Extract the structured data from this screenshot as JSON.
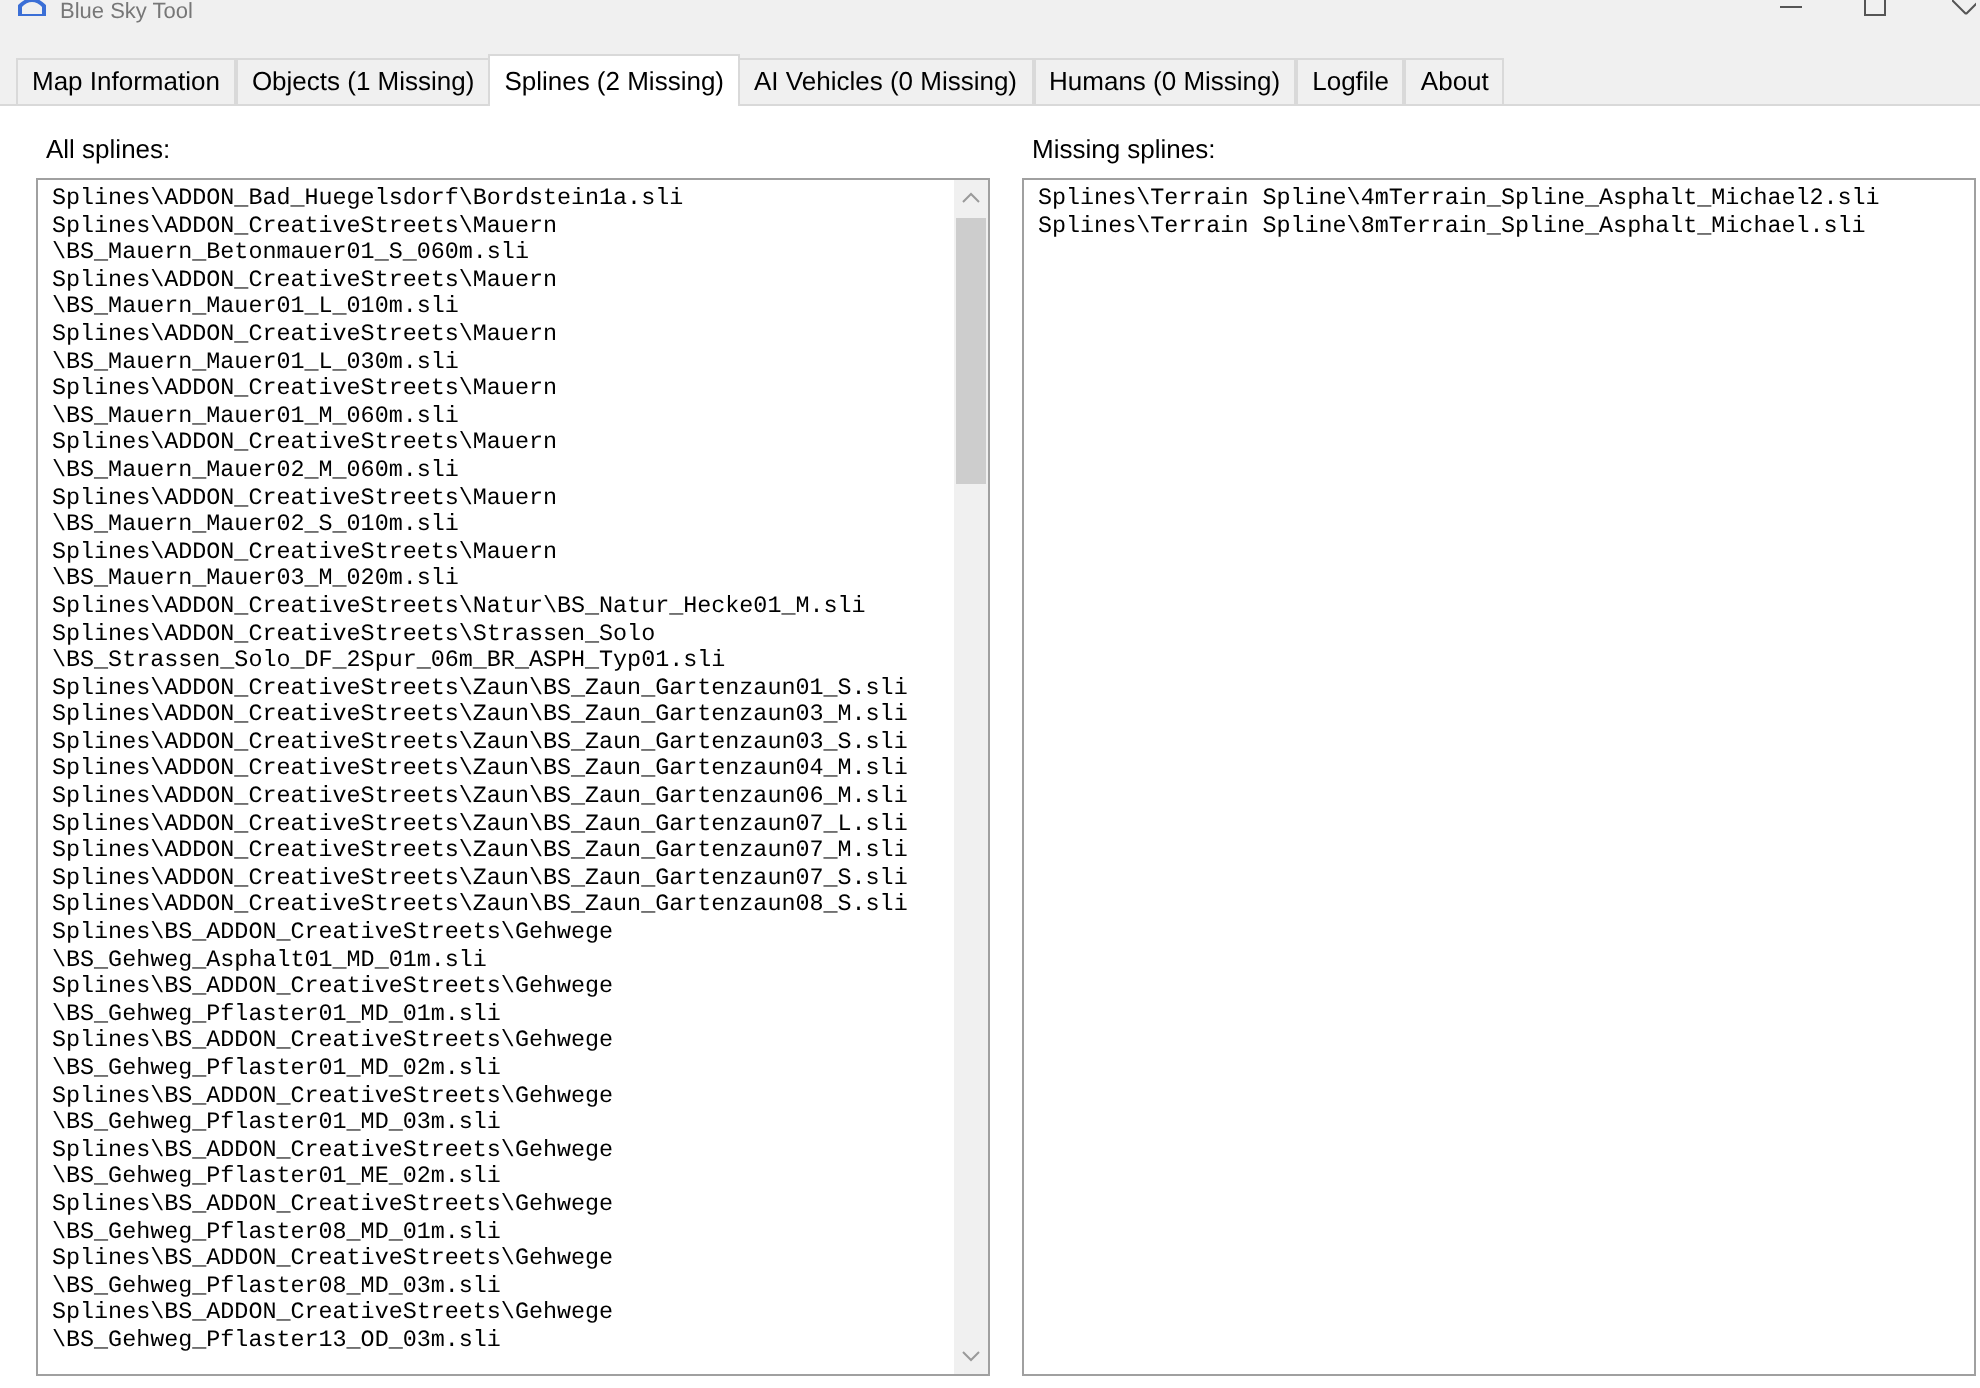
{
  "window": {
    "title": "Blue Sky Tool"
  },
  "tabs": [
    {
      "label": "Map Information",
      "selected": false
    },
    {
      "label": "Objects (1 Missing)",
      "selected": false
    },
    {
      "label": "Splines (2 Missing)",
      "selected": true
    },
    {
      "label": "AI Vehicles (0 Missing)",
      "selected": false
    },
    {
      "label": "Humans (0 Missing)",
      "selected": false
    },
    {
      "label": "Logfile",
      "selected": false
    },
    {
      "label": "About",
      "selected": false
    }
  ],
  "all_splines": {
    "label": "All splines:",
    "lines": [
      "Splines\\ADDON_Bad_Huegelsdorf\\Bordstein1a.sli",
      "Splines\\ADDON_CreativeStreets\\Mauern",
      "\\BS_Mauern_Betonmauer01_S_060m.sli",
      "Splines\\ADDON_CreativeStreets\\Mauern",
      "\\BS_Mauern_Mauer01_L_010m.sli",
      "Splines\\ADDON_CreativeStreets\\Mauern",
      "\\BS_Mauern_Mauer01_L_030m.sli",
      "Splines\\ADDON_CreativeStreets\\Mauern",
      "\\BS_Mauern_Mauer01_M_060m.sli",
      "Splines\\ADDON_CreativeStreets\\Mauern",
      "\\BS_Mauern_Mauer02_M_060m.sli",
      "Splines\\ADDON_CreativeStreets\\Mauern",
      "\\BS_Mauern_Mauer02_S_010m.sli",
      "Splines\\ADDON_CreativeStreets\\Mauern",
      "\\BS_Mauern_Mauer03_M_020m.sli",
      "Splines\\ADDON_CreativeStreets\\Natur\\BS_Natur_Hecke01_M.sli",
      "Splines\\ADDON_CreativeStreets\\Strassen_Solo",
      "\\BS_Strassen_Solo_DF_2Spur_06m_BR_ASPH_Typ01.sli",
      "Splines\\ADDON_CreativeStreets\\Zaun\\BS_Zaun_Gartenzaun01_S.sli",
      "Splines\\ADDON_CreativeStreets\\Zaun\\BS_Zaun_Gartenzaun03_M.sli",
      "Splines\\ADDON_CreativeStreets\\Zaun\\BS_Zaun_Gartenzaun03_S.sli",
      "Splines\\ADDON_CreativeStreets\\Zaun\\BS_Zaun_Gartenzaun04_M.sli",
      "Splines\\ADDON_CreativeStreets\\Zaun\\BS_Zaun_Gartenzaun06_M.sli",
      "Splines\\ADDON_CreativeStreets\\Zaun\\BS_Zaun_Gartenzaun07_L.sli",
      "Splines\\ADDON_CreativeStreets\\Zaun\\BS_Zaun_Gartenzaun07_M.sli",
      "Splines\\ADDON_CreativeStreets\\Zaun\\BS_Zaun_Gartenzaun07_S.sli",
      "Splines\\ADDON_CreativeStreets\\Zaun\\BS_Zaun_Gartenzaun08_S.sli",
      "Splines\\BS_ADDON_CreativeStreets\\Gehwege",
      "\\BS_Gehweg_Asphalt01_MD_01m.sli",
      "Splines\\BS_ADDON_CreativeStreets\\Gehwege",
      "\\BS_Gehweg_Pflaster01_MD_01m.sli",
      "Splines\\BS_ADDON_CreativeStreets\\Gehwege",
      "\\BS_Gehweg_Pflaster01_MD_02m.sli",
      "Splines\\BS_ADDON_CreativeStreets\\Gehwege",
      "\\BS_Gehweg_Pflaster01_MD_03m.sli",
      "Splines\\BS_ADDON_CreativeStreets\\Gehwege",
      "\\BS_Gehweg_Pflaster01_ME_02m.sli",
      "Splines\\BS_ADDON_CreativeStreets\\Gehwege",
      "\\BS_Gehweg_Pflaster08_MD_01m.sli",
      "Splines\\BS_ADDON_CreativeStreets\\Gehwege",
      "\\BS_Gehweg_Pflaster08_MD_03m.sli",
      "Splines\\BS_ADDON_CreativeStreets\\Gehwege",
      "\\BS_Gehweg_Pflaster13_OD_03m.sli"
    ]
  },
  "missing_splines": {
    "label": "Missing splines:",
    "lines": [
      "Splines\\Terrain Spline\\4mTerrain_Spline_Asphalt_Michael2.sli",
      "Splines\\Terrain Spline\\8mTerrain_Spline_Asphalt_Michael.sli"
    ]
  }
}
